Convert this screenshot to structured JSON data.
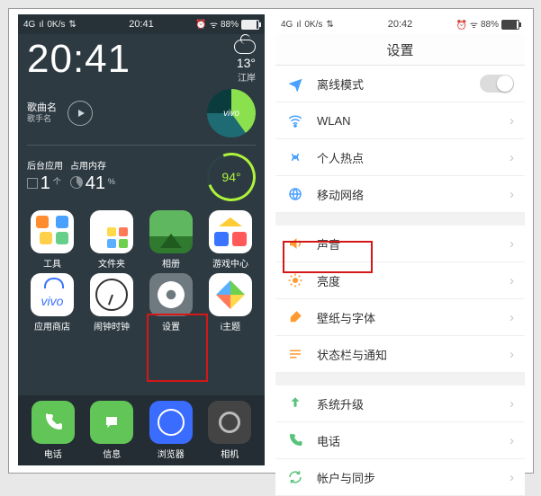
{
  "status": {
    "net": "4G",
    "speed": "0K/s",
    "time_left": "20:41",
    "time_right": "20:42",
    "battery_pct": "88%"
  },
  "home": {
    "clock": "20:41",
    "temp": "13°",
    "location": "江岸",
    "song_title": "歌曲名",
    "song_artist": "歌手名",
    "brand": "vivo",
    "bg_apps_label": "后台应用",
    "bg_apps_count": "1",
    "bg_apps_unit": "个",
    "mem_label": "占用内存",
    "mem_pct": "41",
    "mem_unit": "%",
    "ring_value": "94°",
    "apps": {
      "tools": "工具",
      "folder": "文件夹",
      "album": "相册",
      "game": "游戏中心",
      "store": "应用商店",
      "clock": "闹钟时钟",
      "settings": "设置",
      "theme": "i主题",
      "phone": "电话",
      "msg": "信息",
      "browser": "浏览器",
      "camera": "相机"
    },
    "store_text": "vivo"
  },
  "settings": {
    "title": "设置",
    "items": {
      "airplane": "离线模式",
      "wlan": "WLAN",
      "hotspot": "个人热点",
      "mobile": "移动网络",
      "sound": "声音",
      "brightness": "亮度",
      "wallpaper": "壁纸与字体",
      "statusbar": "状态栏与通知",
      "upgrade": "系统升级",
      "phone": "电话",
      "sync": "帐户与同步"
    }
  }
}
